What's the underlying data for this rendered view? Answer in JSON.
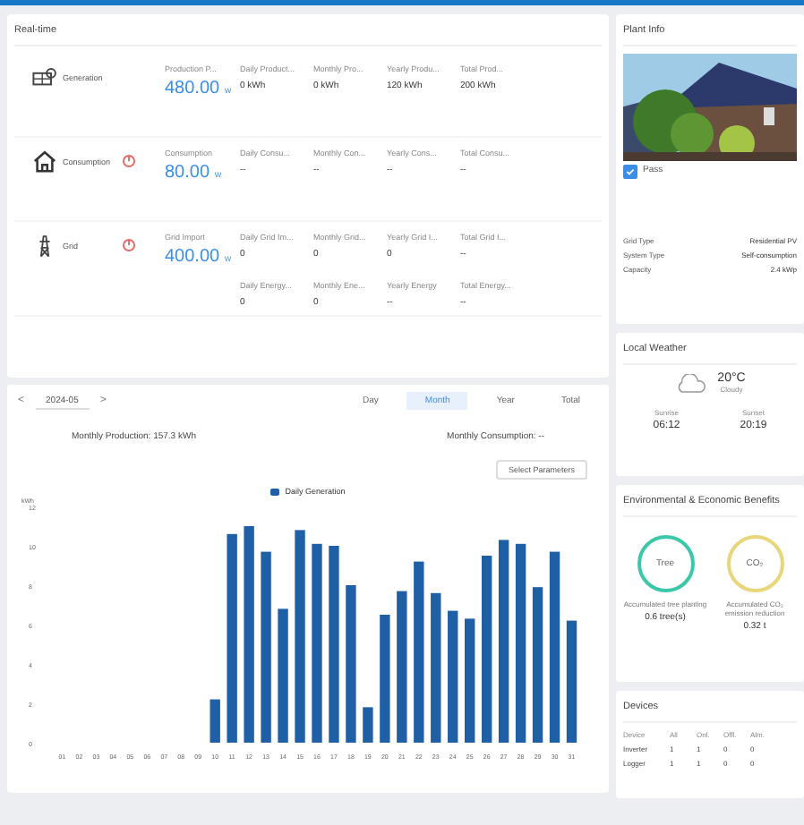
{
  "realtime": {
    "title": "Real-time",
    "rows": [
      {
        "kind": "pv",
        "label": "Generation",
        "alert": false,
        "main": {
          "label": "Production P...",
          "value": "480.00",
          "unit": "W"
        },
        "fields": [
          {
            "label": "Daily Product...",
            "value": "0 kWh"
          },
          {
            "label": "Monthly Pro...",
            "value": "0 kWh"
          },
          {
            "label": "Yearly Produ...",
            "value": "120 kWh"
          },
          {
            "label": "Total Prod...",
            "value": "200 kWh"
          }
        ],
        "extra": []
      },
      {
        "kind": "home",
        "label": "Consumption",
        "alert": true,
        "main": {
          "label": "Consumption",
          "value": "80.00",
          "unit": "W"
        },
        "fields": [
          {
            "label": "Daily Consu...",
            "value": "--"
          },
          {
            "label": "Monthly Con...",
            "value": "--"
          },
          {
            "label": "Yearly Cons...",
            "value": "--"
          },
          {
            "label": "Total Consu...",
            "value": "--"
          }
        ],
        "extra": []
      },
      {
        "kind": "grid",
        "label": "Grid",
        "alert": true,
        "main": {
          "label": "Grid Import",
          "value": "400.00",
          "unit": "W"
        },
        "fields": [
          {
            "label": "Daily Grid Im...",
            "value": "0"
          },
          {
            "label": "Monthly Grid...",
            "value": "0"
          },
          {
            "label": "Yearly Grid I...",
            "value": "0"
          },
          {
            "label": "Total Grid I...",
            "value": "--"
          }
        ],
        "extra": [
          {
            "label": "Daily Energy...",
            "value": "0"
          },
          {
            "label": "Monthly Ene...",
            "value": "0"
          },
          {
            "label": "Yearly Energy",
            "value": "--"
          },
          {
            "label": "Total Energy...",
            "value": "--"
          }
        ]
      }
    ]
  },
  "chart_panel": {
    "prev": "<",
    "period": "2024-05",
    "next": ">",
    "tabs": [
      {
        "label": "Day",
        "selected": false
      },
      {
        "label": "Month",
        "selected": true
      },
      {
        "label": "Year",
        "selected": false
      },
      {
        "label": "Total",
        "selected": false
      }
    ],
    "production": "Monthly Production: 157.3 kWh",
    "consumption": "Monthly Consumption: --",
    "select": "Select Parameters",
    "chart_data": {
      "type": "bar",
      "ylabel": "kWh",
      "categories": [
        "01",
        "02",
        "03",
        "04",
        "05",
        "06",
        "07",
        "08",
        "09",
        "10",
        "11",
        "12",
        "13",
        "14",
        "15",
        "16",
        "17",
        "18",
        "19",
        "20",
        "21",
        "22",
        "23",
        "24",
        "25",
        "26",
        "27",
        "28",
        "29",
        "30",
        "31"
      ],
      "series": [
        {
          "name": "Daily Generation",
          "color": "#1f5fa6",
          "values": [
            0,
            0,
            0,
            0,
            0,
            0,
            0,
            0,
            0,
            2.2,
            10.6,
            11.0,
            9.7,
            6.8,
            10.8,
            10.1,
            10.0,
            8.0,
            1.8,
            6.5,
            7.7,
            9.2,
            7.6,
            6.7,
            6.3,
            9.5,
            10.3,
            10.1,
            7.9,
            9.7,
            6.2
          ]
        }
      ],
      "ylim": [
        0,
        12
      ],
      "yticks": [
        0,
        2,
        4,
        6,
        8,
        10,
        12
      ]
    }
  },
  "plant_info": {
    "title": "Plant Info",
    "status": {
      "label": "Pass",
      "checked": true
    },
    "rows": [
      {
        "label": "Grid Type",
        "value": "Residential PV"
      },
      {
        "label": "System Type",
        "value": "Self-consumption"
      },
      {
        "label": "Capacity",
        "value": "2.4 kWp"
      }
    ]
  },
  "weather": {
    "title": "Local Weather",
    "temp": "20°C",
    "condition": "Cloudy",
    "sunrise_label": "Sunrise",
    "sunrise": "06:12",
    "sunset_label": "Sunset",
    "sunset": "20:19"
  },
  "benefits": {
    "title": "Environmental & Economic Benefits",
    "items": [
      {
        "symbol": "Tree",
        "color": "#3cc8a8",
        "label": "Accumulated tree planting",
        "value": "0.6 tree(s)"
      },
      {
        "symbol": "CO₂",
        "color": "#e8d67a",
        "label": "Accumulated CO₂ emission reduction",
        "value": "0.32 t"
      }
    ]
  },
  "devices": {
    "title": "Devices",
    "columns": [
      "Device",
      "All",
      "Onl.",
      "Offl.",
      "Alm."
    ],
    "rows": [
      [
        "Inverter",
        "1",
        "1",
        "0",
        "0"
      ],
      [
        "Logger",
        "1",
        "1",
        "0",
        "0"
      ]
    ]
  }
}
